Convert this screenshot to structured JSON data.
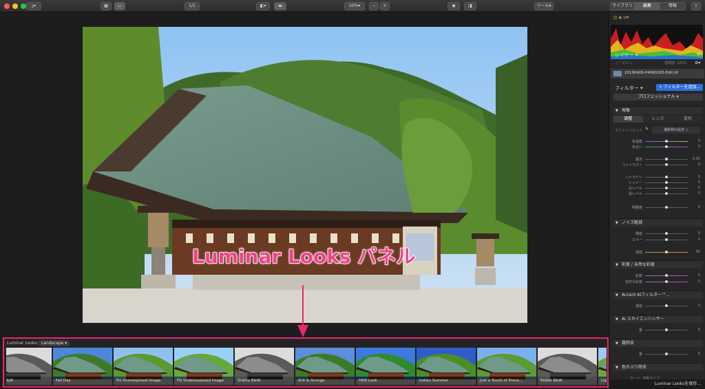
{
  "toolbar": {
    "zoom": "50%",
    "zoom_minus": "−",
    "zoom_plus": "+",
    "ratio": "1/1",
    "tools": "ツール",
    "tabs": [
      "ライブラリ",
      "編集",
      "情報"
    ],
    "selected_tab": "編集"
  },
  "annotation": {
    "text": "Luminar Looks パネル"
  },
  "looks": {
    "label": "Luminar Looks:",
    "category": "Landscape",
    "items": [
      {
        "name": "Airy B&W",
        "bw": true
      },
      {
        "name": "Fall Day",
        "bw": false
      },
      {
        "name": "Fix Overexposed Image",
        "bw": false
      },
      {
        "name": "Fix Underexposed Image",
        "bw": false
      },
      {
        "name": "Grainy B&W",
        "bw": true
      },
      {
        "name": "Grit & Grunge",
        "bw": false
      },
      {
        "name": "HDR Look",
        "bw": false
      },
      {
        "name": "Indian Summer",
        "bw": false
      },
      {
        "name": "Just a Touch of Proce...",
        "bw": false
      },
      {
        "name": "Kodak B&W",
        "bw": true
      },
      {
        "name": "Lightne",
        "bw": false
      }
    ]
  },
  "sidebar": {
    "layers_title": "レイヤー",
    "normal_mode": "ノーマル",
    "opacity": "透明度: 100%",
    "layer_name": "20190406-P4060183-Edit.tif",
    "filters_title": "フィルター",
    "add_filter": "+ フィルターを追加...",
    "workspace": "プロフェッショナル",
    "sections": {
      "develop": {
        "title": "現像",
        "tabs": [
          "調整",
          "レンズ",
          "変形"
        ],
        "white_balance_label": "ホワイトバランス",
        "white_balance_value": "撮影時の設定",
        "rows": [
          {
            "label": "色温度",
            "value": "0"
          },
          {
            "label": "色合い",
            "value": "0"
          },
          {
            "label": "露出",
            "value": "0.00"
          },
          {
            "label": "コントラスト",
            "value": "0"
          },
          {
            "label": "ハイライト",
            "value": "0"
          },
          {
            "label": "シャドー",
            "value": "0"
          },
          {
            "label": "白レベル",
            "value": "0"
          },
          {
            "label": "黒レベル",
            "value": "0"
          },
          {
            "label": "明瞭度",
            "value": "0"
          }
        ]
      },
      "noise": {
        "title": "ノイズ軽減",
        "rows": [
          {
            "label": "輝度",
            "value": "0"
          },
          {
            "label": "カラー",
            "value": "0"
          },
          {
            "label": "増強",
            "value": "50"
          }
        ]
      },
      "saturation": {
        "title": "彩度 / 自然な彩度",
        "rows": [
          {
            "label": "彩度",
            "value": "0"
          },
          {
            "label": "自然な彩度",
            "value": "0"
          }
        ]
      },
      "accent": {
        "title": "Accent AIフィルター™...",
        "rows": [
          {
            "label": "増強",
            "value": "0"
          }
        ]
      },
      "sky": {
        "title": "AI スカイエンハンサー",
        "rows": [
          {
            "label": "量",
            "value": "0"
          }
        ]
      },
      "dehaze": {
        "title": "霧除去",
        "rows": [
          {
            "label": "量",
            "value": "0"
          }
        ]
      },
      "fringe": {
        "title": "色かぶり除去",
        "mode_label": "モード",
        "mode_value": "自動タイプ"
      }
    },
    "status": "Luminar Looksを保存..."
  },
  "colors": {
    "accent": "#e9286e",
    "selection_blue": "#2f6fdc",
    "panel": "#262628"
  }
}
